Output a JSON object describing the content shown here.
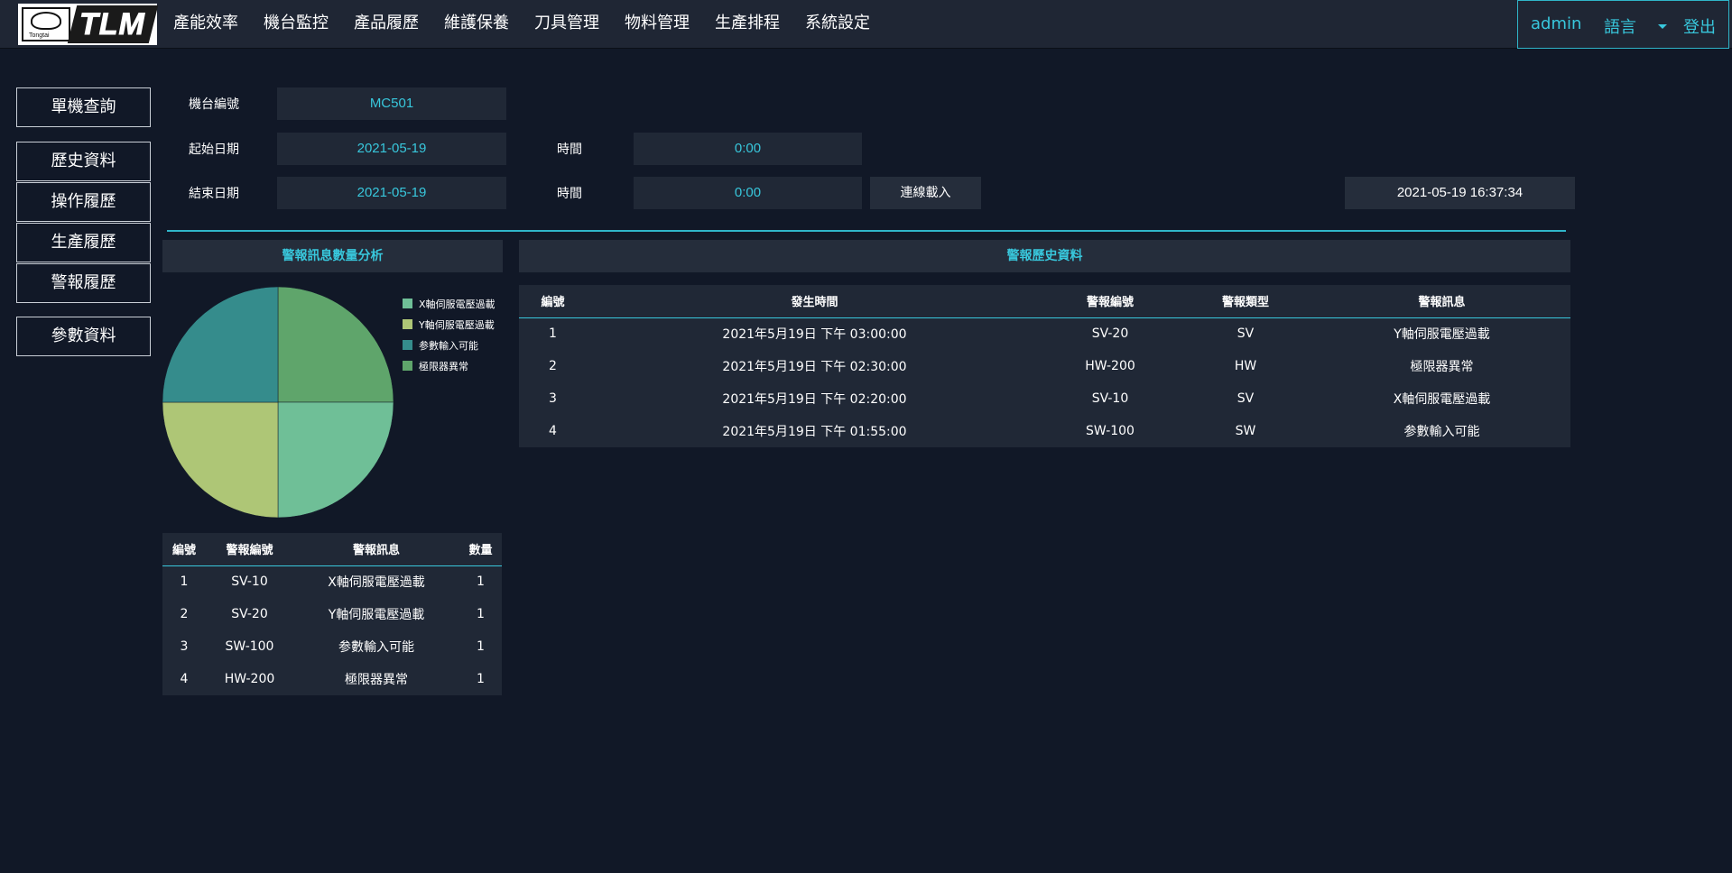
{
  "header": {
    "logo": {
      "brand": "TLM",
      "sub": "Tongtai"
    },
    "nav": [
      "產能效率",
      "機台監控",
      "產品履歷",
      "維護保養",
      "刀具管理",
      "物料管理",
      "生產排程",
      "系統設定"
    ],
    "user": "admin",
    "language": "語言",
    "logout": "登出"
  },
  "sidebar": {
    "single_query": "單機查詢",
    "items": [
      "歷史資料",
      "操作履歷",
      "生產履歷",
      "警報履歷"
    ],
    "params": "參數資料"
  },
  "form": {
    "machine_label": "機台編號",
    "machine_value": "MC501",
    "start_date_label": "起始日期",
    "start_date": "2021-05-19",
    "start_time_label": "時間",
    "start_time": "0:00",
    "end_date_label": "結束日期",
    "end_date": "2021-05-19",
    "end_time_label": "時間",
    "end_time": "0:00",
    "load_button": "連線載入",
    "current_time": "2021-05-19 16:37:34"
  },
  "analysis": {
    "title": "警報訊息數量分析",
    "legend": [
      {
        "label": "X軸伺服電壓過載",
        "color": "#6fbf97"
      },
      {
        "label": "Y軸伺服電壓過載",
        "color": "#aec676"
      },
      {
        "label": "参數輸入可能",
        "color": "#358c8c"
      },
      {
        "label": "極限器異常",
        "color": "#5fa56b"
      }
    ],
    "table": {
      "headers": [
        "編號",
        "警報編號",
        "警報訊息",
        "數量"
      ],
      "rows": [
        [
          "1",
          "SV-10",
          "X軸伺服電壓過載",
          "1"
        ],
        [
          "2",
          "SV-20",
          "Y軸伺服電壓過載",
          "1"
        ],
        [
          "3",
          "SW-100",
          "参數輸入可能",
          "1"
        ],
        [
          "4",
          "HW-200",
          "極限器異常",
          "1"
        ]
      ]
    }
  },
  "chart_data": {
    "type": "pie",
    "categories": [
      "X軸伺服電壓過載",
      "Y軸伺服電壓過載",
      "参數輸入可能",
      "極限器異常"
    ],
    "values": [
      1,
      1,
      1,
      1
    ],
    "colors": [
      "#6fbf97",
      "#aec676",
      "#358c8c",
      "#5fa56b"
    ],
    "legend": "right"
  },
  "history": {
    "title": "警報歷史資料",
    "headers": [
      "編號",
      "發生時間",
      "警報編號",
      "警報類型",
      "警報訊息"
    ],
    "rows": [
      [
        "1",
        "2021年5月19日 下午 03:00:00",
        "SV-20",
        "SV",
        "Y軸伺服電壓過載"
      ],
      [
        "2",
        "2021年5月19日 下午 02:30:00",
        "HW-200",
        "HW",
        "極限器異常"
      ],
      [
        "3",
        "2021年5月19日 下午 02:20:00",
        "SV-10",
        "SV",
        "X軸伺服電壓過載"
      ],
      [
        "4",
        "2021年5月19日 下午 01:55:00",
        "SW-100",
        "SW",
        "参數輸入可能"
      ]
    ]
  }
}
